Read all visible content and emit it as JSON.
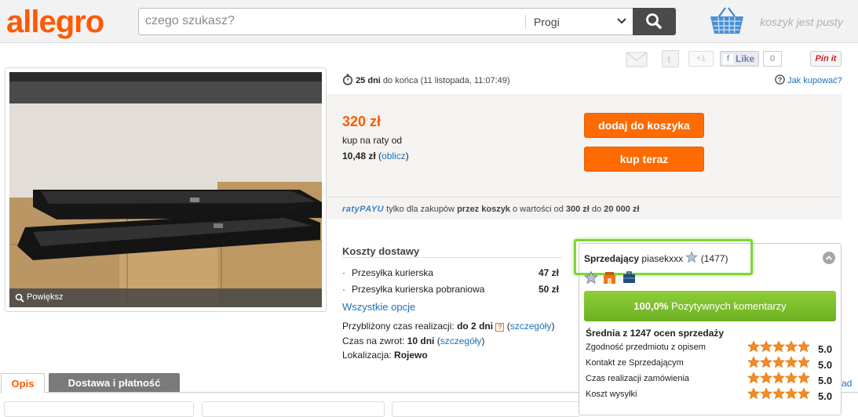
{
  "header": {
    "logo": "allegro",
    "search_placeholder": "czego szukasz?",
    "search_category": "Progi",
    "cart_text": "koszyk jest pusty"
  },
  "share": {
    "gplus": "+1",
    "fb_like": "Like",
    "fb_count": "0",
    "pinit": "Pin it"
  },
  "photo": {
    "zoom_label": "Powiększ"
  },
  "auction": {
    "time_left": "25 dni",
    "time_rest": "do końca (11 listopada, 11:07:49)",
    "help_link": "Jak kupować?",
    "price": "320 zł",
    "raty_label": "kup na raty od",
    "raty_value": "10,48 zł",
    "raty_open": "(",
    "raty_link": "oblicz",
    "raty_close": ")",
    "add_to_cart": "dodaj do koszyka",
    "buy_now": "kup teraz",
    "ratypayu_logo": "ratyPAYU",
    "ratypayu_t1": "tylko dla zakupów",
    "ratypayu_b1": "przez koszyk",
    "ratypayu_t2": "o wartości od",
    "ratypayu_b2": "300 zł",
    "ratypayu_t3": "do",
    "ratypayu_b3": "20 000 zł"
  },
  "shipping": {
    "title": "Koszty dostawy",
    "options": [
      {
        "name": "Przesyłka kurierska",
        "price": "47 zł"
      },
      {
        "name": "Przesyłka kurierska pobraniowa",
        "price": "50 zł"
      }
    ],
    "all_options": "Wszystkie opcje",
    "realization_label": "Przybliżony czas realizacji:",
    "realization_value": "do 2 dni",
    "return_label": "Czas na zwrot:",
    "return_value": "10 dni",
    "location_label": "Lokalizacja:",
    "location_value": "Rojewo",
    "details_link": "szczegóły",
    "paren_open": "(",
    "paren_close": ")"
  },
  "tabs": {
    "opis": "Opis",
    "dostawa": "Dostawa i płatność",
    "cut_link": "ad"
  },
  "seller": {
    "label": "Sprzedający",
    "name": "piasekxxx",
    "count": "(1477)",
    "positive_pct": "100,0%",
    "positive_text": "Pozytywnych komentarzy",
    "avg_title": "Średnia z 1247 ocen sprzedaży",
    "ratings": [
      {
        "label": "Zgodność przedmiotu z opisem",
        "value": "5.0"
      },
      {
        "label": "Kontakt ze Sprzedającym",
        "value": "5.0"
      },
      {
        "label": "Czas realizacji zamówienia",
        "value": "5.0"
      },
      {
        "label": "Koszt wysyłki",
        "value": "5.0"
      }
    ]
  },
  "colors": {
    "brand": "#ff5a00",
    "button": "#ff6b00",
    "link": "#1d70b7",
    "positive": "#7abf2c",
    "highlight": "#7fd43a"
  }
}
